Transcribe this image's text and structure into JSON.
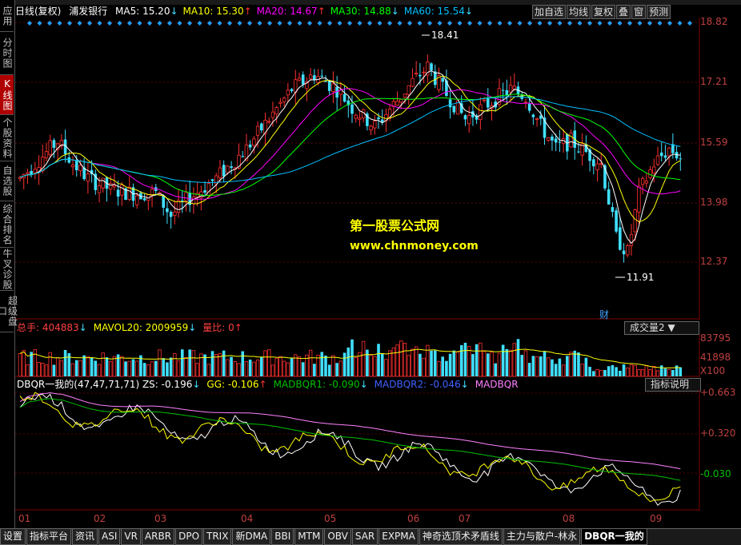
{
  "left_tabs": [
    {
      "label": "应用",
      "active": false
    },
    {
      "label": "分时图",
      "active": false
    },
    {
      "label": "K线图",
      "active": true
    },
    {
      "label": "个股资料",
      "active": false
    },
    {
      "label": "自选股",
      "active": false
    },
    {
      "label": "综合排名",
      "active": false
    },
    {
      "label": "牛叉诊股",
      "active": false
    },
    {
      "label": "超级盘口",
      "active": false
    }
  ],
  "header": {
    "period": "日线(复权)",
    "stock": "浦发银行",
    "ma": [
      {
        "label": "MA5: 15.20",
        "arrow": "↓",
        "color": "#ffffff"
      },
      {
        "label": "MA10: 15.30",
        "arrow": "↑",
        "color": "#ffff00"
      },
      {
        "label": "MA20: 14.67",
        "arrow": "↑",
        "color": "#ff00ff"
      },
      {
        "label": "MA30: 14.88",
        "arrow": "↓",
        "color": "#00ff00"
      },
      {
        "label": "MA60: 15.54",
        "arrow": "↓",
        "color": "#00c0ff"
      }
    ]
  },
  "toolbar": [
    "加自选",
    "均线",
    "复权",
    "叠",
    "窗",
    "预测"
  ],
  "price_axis": [
    "18.82",
    "17.21",
    "15.59",
    "13.98",
    "12.37"
  ],
  "annotations": {
    "high": "18.41",
    "low": "11.91",
    "cai": "财"
  },
  "watermark": {
    "line1": "第一股票公式网",
    "line2": "www.chnmoney.com"
  },
  "volume": {
    "header": [
      {
        "label": "总手: 404883",
        "arrow": "↓",
        "color": "#ff4040"
      },
      {
        "label": "MAVOL20: 2009959",
        "arrow": "↓",
        "color": "#ffff00"
      },
      {
        "label": "量比: 0",
        "arrow": "↑",
        "color": "#ff4040"
      }
    ],
    "button": "成交量2",
    "axis": [
      "83795",
      "41898",
      "X100"
    ]
  },
  "indicator": {
    "header": [
      {
        "label": "DBQR一我的(47,47,71,71) ZS: -0.196",
        "arrow": "↓",
        "color": "#ffffff"
      },
      {
        "label": "GG: -0.106",
        "arrow": "↑",
        "color": "#ffff00"
      },
      {
        "label": "MADBQR1: -0.090",
        "arrow": "↓",
        "color": "#00c000"
      },
      {
        "label": "MADBQR2: -0.046",
        "arrow": "↓",
        "color": "#4060ff"
      },
      {
        "label": "MADBQR",
        "arrow": "",
        "color": "#ff80ff"
      }
    ],
    "button": "指标说明",
    "axis": [
      "+0.663",
      "+0.320",
      "-0.030"
    ]
  },
  "months": [
    "01",
    "02",
    "03",
    "04",
    "05",
    "06",
    "07",
    "08",
    "09"
  ],
  "bottom_tabs": [
    {
      "label": "设置",
      "active": false
    },
    {
      "label": "指标平台",
      "active": false
    },
    {
      "label": "资讯",
      "active": false
    },
    {
      "label": "ASI",
      "active": false
    },
    {
      "label": "VR",
      "active": false
    },
    {
      "label": "ARBR",
      "active": false
    },
    {
      "label": "DPO",
      "active": false
    },
    {
      "label": "TRIX",
      "active": false
    },
    {
      "label": "新DMA",
      "active": false
    },
    {
      "label": "BBI",
      "active": false
    },
    {
      "label": "MTM",
      "active": false
    },
    {
      "label": "OBV",
      "active": false
    },
    {
      "label": "SAR",
      "active": false
    },
    {
      "label": "EXPMA",
      "active": false
    },
    {
      "label": "神奇选顶术矛盾线",
      "active": false
    },
    {
      "label": "主力与散户-林永",
      "active": false
    },
    {
      "label": "DBQR一我的",
      "active": true
    }
  ],
  "colors": {
    "up": "#ff3030",
    "down": "#40e0ff",
    "grid": "#600000",
    "axis": "#c04040"
  }
}
